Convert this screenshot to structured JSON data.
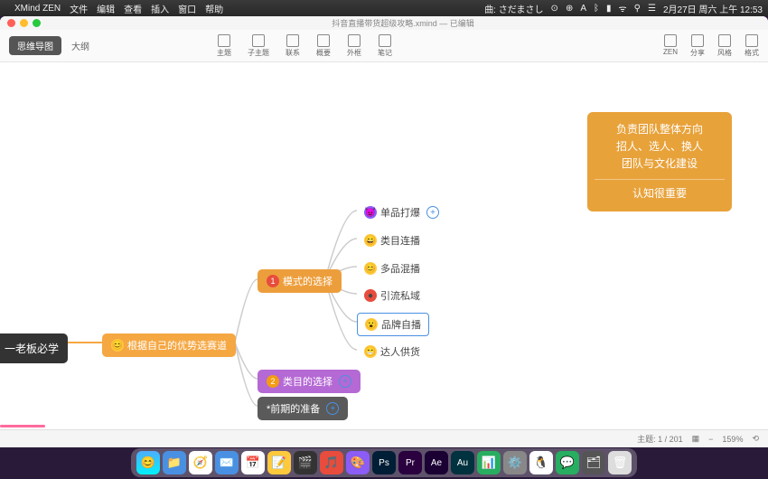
{
  "menubar": {
    "app": "XMind ZEN",
    "items": [
      "文件",
      "编辑",
      "查看",
      "插入",
      "窗口",
      "帮助"
    ],
    "music": "曲: さだまさし",
    "datetime": "2月27日 周六 上午 12:53"
  },
  "window": {
    "title": "抖音直播带货超级攻略.xmind — 已编辑",
    "tabs": {
      "mindmap": "思维导图",
      "outline": "大纲"
    },
    "toolbar": {
      "theme": "主题",
      "sub": "子主题",
      "rel": "联系",
      "summary": "概要",
      "boundary": "外框",
      "note": "笔记",
      "zen": "ZEN",
      "share": "分享",
      "style": "风格",
      "format": "格式"
    }
  },
  "orange": {
    "l1": "负责团队整体方向",
    "l2": "招人、选人、换人",
    "l3": "团队与文化建设",
    "l4": "认知很重要"
  },
  "map": {
    "root": "一老板必学",
    "level1": "根据自己的优势选赛道",
    "mode": "模式的选择",
    "category": "类目的选择",
    "prep": "*前期的准备",
    "leaves": {
      "a": "单品打爆",
      "b": "类目连播",
      "c": "多品混播",
      "d": "引流私域",
      "e": "品牌自播",
      "f": "达人供货"
    }
  },
  "status": {
    "topic": "主题: 1 / 201",
    "zoom": "159%"
  },
  "dock": [
    "🔵",
    "📁",
    "🌐",
    "✉️",
    "📅",
    "📝",
    "🎬",
    "🎵",
    "🎨",
    "Ps",
    "Pr",
    "Ae",
    "Au",
    "📊",
    "⚙️",
    "🐧",
    "💬",
    "🗂",
    "🗑"
  ]
}
